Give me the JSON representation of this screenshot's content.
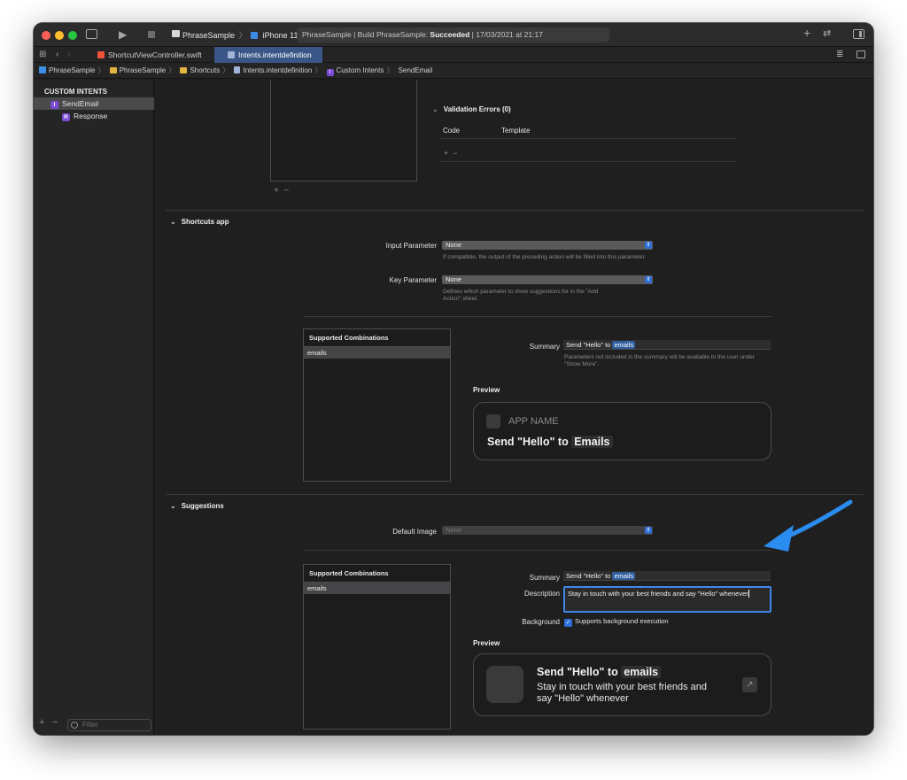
{
  "toolbar": {
    "scheme": "PhraseSample",
    "device": "iPhone 11",
    "status_prefix": "PhraseSample | Build PhraseSample: ",
    "status_result": "Succeeded",
    "status_time": " | 17/03/2021 at 21:17"
  },
  "tabs": [
    {
      "label": "ShortcutViewController.swift"
    },
    {
      "label": "Intents.intentdefinition"
    }
  ],
  "breadcrumb": [
    "PhraseSample",
    "PhraseSample",
    "Shortcuts",
    "Intents.intentdefinition",
    "Custom Intents",
    "SendEmail"
  ],
  "sidebar": {
    "header": "CUSTOM INTENTS",
    "items": [
      {
        "label": "SendEmail",
        "badge": "I"
      },
      {
        "label": "Response",
        "badge": "R"
      }
    ],
    "filter_placeholder": "Filter"
  },
  "validation": {
    "title": "Validation Errors (0)",
    "col_code": "Code",
    "col_template": "Template"
  },
  "shortcuts_app": {
    "title": "Shortcuts app",
    "input_param_label": "Input Parameter",
    "input_param_value": "None",
    "input_param_hint": "If compatible, the output of the preceding action will be filled into this parameter.",
    "key_param_label": "Key Parameter",
    "key_param_value": "None",
    "key_param_hint": "Defines which parameter to show suggestions for in the \"Add Action\" sheet.",
    "combos_header": "Supported Combinations",
    "combos_row": "emails",
    "summary_label": "Summary",
    "summary_text": "Send \"Hello\" to ",
    "summary_token": "emails",
    "summary_hint": "Parameters not included in the summary will be available to the user under \"Show More\".",
    "preview_label": "Preview",
    "preview_app_name": "APP NAME",
    "preview_title": "Send \"Hello\" to ",
    "preview_token": "Emails"
  },
  "suggestions": {
    "title": "Suggestions",
    "default_image_label": "Default Image",
    "default_image_value": "None",
    "combos_header": "Supported Combinations",
    "combos_row": "emails",
    "summary_label": "Summary",
    "summary_text": "Send \"Hello\" to ",
    "summary_token": "emails",
    "description_label": "Description",
    "description_value": "Stay in touch with your best friends and say \"Hello\" whenever",
    "background_label": "Background",
    "background_check": "Supports background execution",
    "preview_label": "Preview",
    "preview_title": "Send \"Hello\" to ",
    "preview_token": "emails",
    "preview_body": "Stay in touch with your best friends and say \"Hello\" whenever"
  },
  "colors": {
    "accent": "#2f6fd8",
    "annotation_arrow": "#2b8cf0"
  }
}
